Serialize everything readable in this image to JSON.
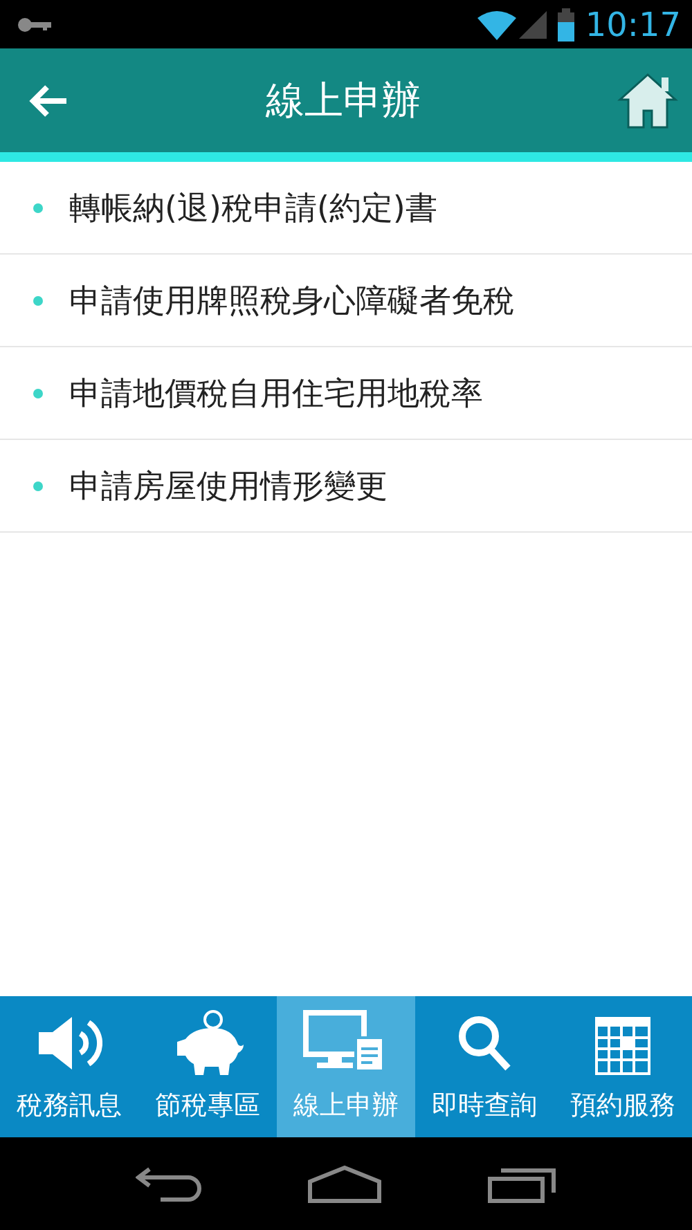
{
  "status_bar": {
    "time": "10:17"
  },
  "header": {
    "title": "線上申辦"
  },
  "items": [
    {
      "label": "轉帳納(退)稅申請(約定)書"
    },
    {
      "label": "申請使用牌照稅身心障礙者免稅"
    },
    {
      "label": "申請地價稅自用住宅用地稅率"
    },
    {
      "label": "申請房屋使用情形變更"
    }
  ],
  "tabs": [
    {
      "label": "稅務訊息",
      "selected": false
    },
    {
      "label": "節稅專區",
      "selected": false
    },
    {
      "label": "線上申辦",
      "selected": true
    },
    {
      "label": "即時查詢",
      "selected": false
    },
    {
      "label": "預約服務",
      "selected": false
    }
  ]
}
